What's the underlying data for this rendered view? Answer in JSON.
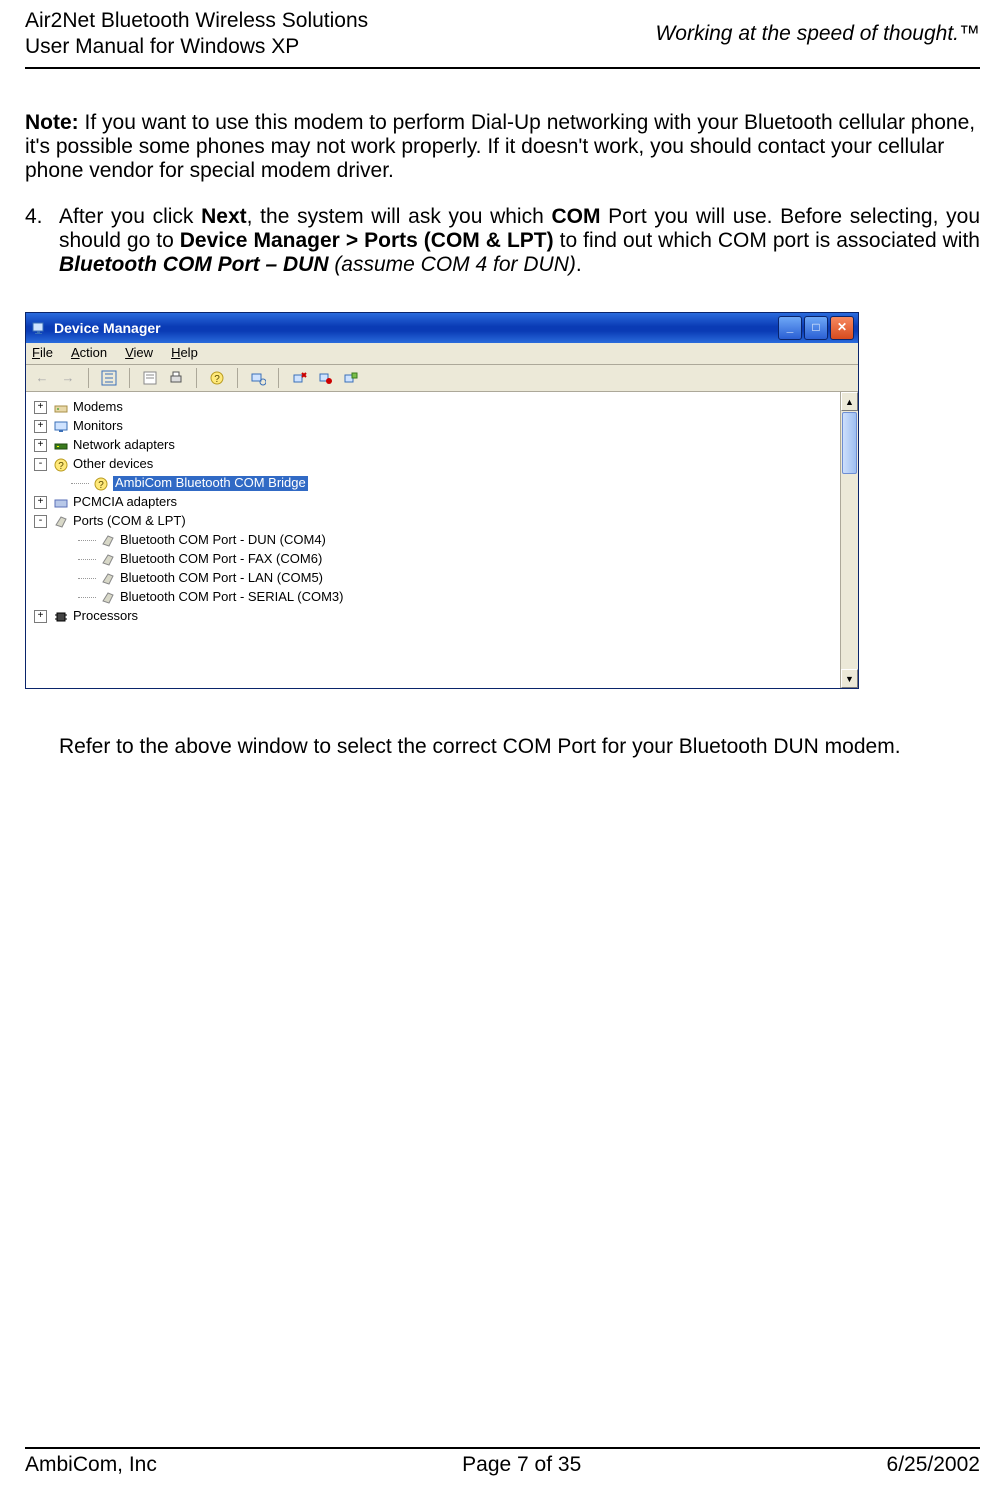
{
  "header": {
    "title_line1": "Air2Net Bluetooth Wireless Solutions",
    "title_line2": "User Manual for Windows XP",
    "tagline": "Working at the speed of thought.™"
  },
  "note": {
    "label": "Note:",
    "text": " If you want to use this modem to perform Dial-Up networking with your Bluetooth cellular phone, it's possible some phones may not work properly. If it doesn't work, you should contact your cellular phone vendor for special modem driver."
  },
  "step4": {
    "num": "4.",
    "pre": "After you click ",
    "next": "Next",
    "mid1": ", the system will ask you which ",
    "com": "COM",
    "mid2": " Port you will use. Before selecting, you should go to ",
    "dm": "Device Manager > Ports (COM & LPT)",
    "mid3": " to find out which COM port is associated with ",
    "btport": "Bluetooth COM Port – DUN",
    "assume": " (assume COM 4 for DUN)",
    "period": "."
  },
  "window": {
    "title": "Device Manager",
    "menus": {
      "file": "File",
      "action": "Action",
      "view": "View",
      "help": "Help"
    },
    "tree": {
      "modems": "Modems",
      "monitors": "Monitors",
      "network": "Network adapters",
      "other": "Other devices",
      "ambicom": "AmbiCom Bluetooth COM Bridge",
      "pcmcia": "PCMCIA adapters",
      "ports": "Ports (COM & LPT)",
      "dun": "Bluetooth COM Port - DUN (COM4)",
      "fax": "Bluetooth COM Port - FAX (COM6)",
      "lan": "Bluetooth COM Port - LAN (COM5)",
      "serial": "Bluetooth COM Port - SERIAL (COM3)",
      "processors": "Processors"
    }
  },
  "after": "Refer to the above window to select the correct COM Port for your Bluetooth DUN modem.",
  "footer": {
    "left": "AmbiCom, Inc",
    "center": "Page 7 of 35",
    "right": "6/25/2002"
  }
}
